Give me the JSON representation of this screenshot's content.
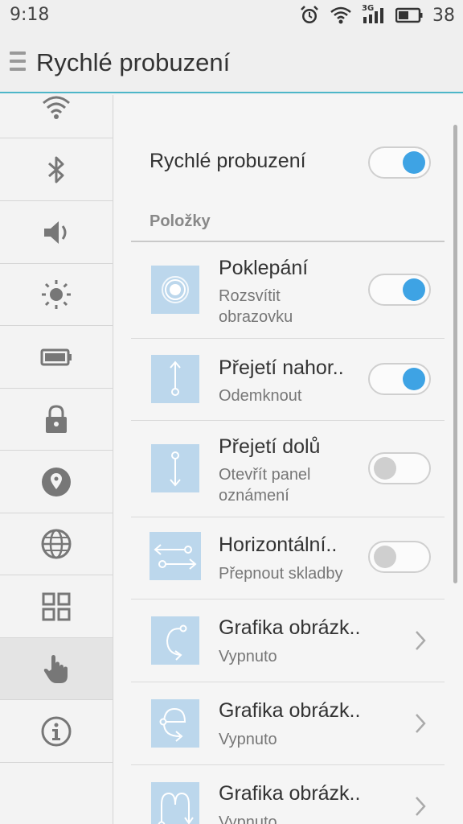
{
  "status_bar": {
    "time": "9:18",
    "network": "3G",
    "battery": "38",
    "icons": [
      "alarm-icon",
      "wifi-icon",
      "signal-icon",
      "battery-icon"
    ]
  },
  "header": {
    "title": "Rychlé probuzení",
    "menu_icon": "hamburger-icon"
  },
  "sidebar": {
    "items": [
      {
        "icon": "wifi-icon",
        "active": false
      },
      {
        "icon": "bluetooth-icon",
        "active": false
      },
      {
        "icon": "volume-icon",
        "active": false
      },
      {
        "icon": "brightness-icon",
        "active": false
      },
      {
        "icon": "battery-icon",
        "active": false
      },
      {
        "icon": "lock-icon",
        "active": false
      },
      {
        "icon": "location-icon",
        "active": false
      },
      {
        "icon": "globe-icon",
        "active": false
      },
      {
        "icon": "apps-grid-icon",
        "active": false
      },
      {
        "icon": "hand-gesture-icon",
        "active": true
      },
      {
        "icon": "info-icon",
        "active": false
      }
    ]
  },
  "main_toggle": {
    "label": "Rychlé probuzení",
    "on": true
  },
  "section_title": "Položky",
  "items": [
    {
      "icon": "double-tap-icon",
      "title": "Poklepání",
      "subtitle": "Rozsvítit obrazovku",
      "control": "toggle",
      "on": true
    },
    {
      "icon": "swipe-up-icon",
      "title": "Přejetí nahor..",
      "subtitle": "Odemknout",
      "control": "toggle",
      "on": true
    },
    {
      "icon": "swipe-down-icon",
      "title": "Přejetí dolů",
      "subtitle": "Otevřít panel oznámení",
      "control": "toggle",
      "on": false
    },
    {
      "icon": "swipe-horizontal-icon",
      "title": "Horizontální..",
      "subtitle": "Přepnout skladby",
      "control": "toggle",
      "on": false
    },
    {
      "icon": "gesture-c-icon",
      "title": "Grafika obrázk..",
      "subtitle": "Vypnuto",
      "control": "chevron"
    },
    {
      "icon": "gesture-e-icon",
      "title": "Grafika obrázk..",
      "subtitle": "Vypnuto",
      "control": "chevron"
    },
    {
      "icon": "gesture-m-icon",
      "title": "Grafika obrázk..",
      "subtitle": "Vypnuto",
      "control": "chevron"
    }
  ],
  "colors": {
    "accent": "#3ea3e4",
    "header_line": "#4db6c8",
    "thumb_bg": "#bcd7ec"
  }
}
